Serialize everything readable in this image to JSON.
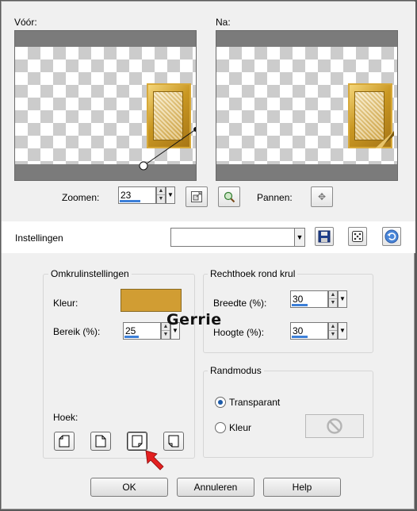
{
  "preview": {
    "before_label": "Vóór:",
    "after_label": "Na:"
  },
  "zoom": {
    "label": "Zoomen:",
    "value": "23",
    "pan_label": "Pannen:"
  },
  "settings": {
    "label": "Instellingen",
    "preset_value": ""
  },
  "curl_settings": {
    "title": "Omkrulinstellingen",
    "color_label": "Kleur:",
    "color": "#d19d33",
    "range_label": "Bereik (%):",
    "range_value": "25",
    "corner_label": "Hoek:",
    "corners": [
      "top-left",
      "top-right",
      "bottom-right",
      "bottom-left"
    ],
    "selected_corner": "bottom-right"
  },
  "rect_curl": {
    "title": "Rechthoek rond krul",
    "width_label": "Breedte (%):",
    "width_value": "30",
    "height_label": "Hoogte (%):",
    "height_value": "30"
  },
  "edge_mode": {
    "title": "Randmodus",
    "options": [
      "Transparant",
      "Kleur"
    ],
    "selected": "Transparant"
  },
  "watermark": "Gerrie",
  "buttons": {
    "ok": "OK",
    "cancel": "Annuleren",
    "help": "Help"
  }
}
